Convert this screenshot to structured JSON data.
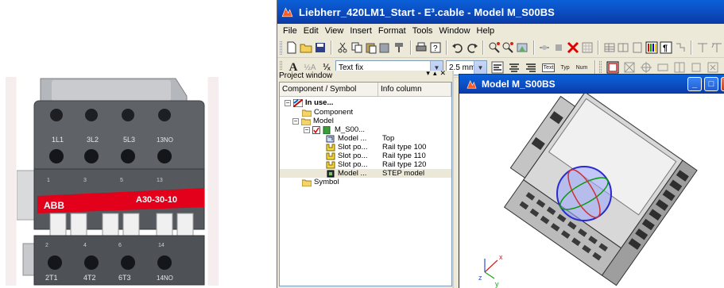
{
  "photo": {
    "brand": "ABB",
    "model_label": "A30-30-10",
    "top_terminals": [
      "1L1",
      "3L2",
      "5L3",
      "13NO"
    ],
    "bottom_terminals": [
      "2T1",
      "4T2",
      "6T3",
      "14NO"
    ],
    "top_numbers": [
      "1",
      "3",
      "5",
      "13"
    ],
    "bottom_numbers": [
      "2",
      "4",
      "6",
      "14"
    ]
  },
  "app": {
    "title": "Liebherr_420LM1_Start - E³.cable - Model M_S00BS",
    "menu": [
      "File",
      "Edit",
      "View",
      "Insert",
      "Format",
      "Tools",
      "Window",
      "Help"
    ],
    "text_style": "Text fix",
    "text_size": "2.5 mm",
    "btn_text": "Text",
    "btn_typ": "Typ",
    "btn_num": "Num"
  },
  "project_window": {
    "title": "Project window",
    "col_component": "Component / Symbol",
    "col_info": "Info column",
    "rows": [
      {
        "name": "In use...",
        "info": ""
      },
      {
        "name": "Component",
        "info": ""
      },
      {
        "name": "Model",
        "info": ""
      },
      {
        "name": "M_S00...",
        "info": ""
      },
      {
        "name": "Model ...",
        "info": "Top"
      },
      {
        "name": "Slot po...",
        "info": "Rail type 100"
      },
      {
        "name": "Slot po...",
        "info": "Rail type 110"
      },
      {
        "name": "Slot po...",
        "info": "Rail type 120"
      },
      {
        "name": "Model ...",
        "info": "STEP model"
      },
      {
        "name": "Symbol",
        "info": ""
      }
    ]
  },
  "model_window": {
    "title": "Model M_S00BS",
    "axis_x": "x",
    "axis_y": "y",
    "axis_z": "z"
  },
  "colors": {
    "title_blue": "#0c52c8",
    "panel": "#ece9d8",
    "abb_red": "#e2001a",
    "contactor_grey": "#5b5e63"
  }
}
